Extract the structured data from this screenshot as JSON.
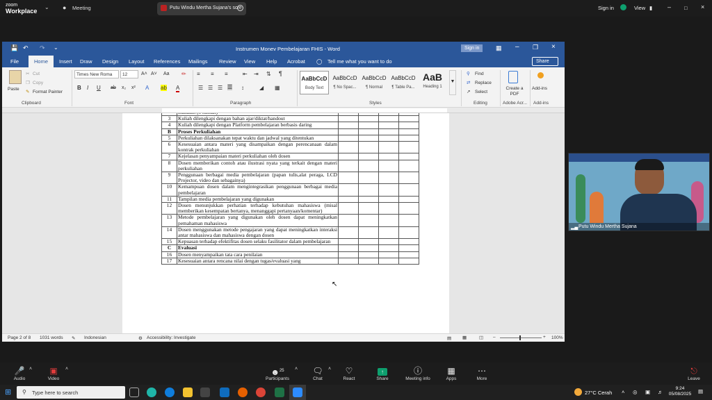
{
  "zoom_top": {
    "logo_line1": "zoom",
    "logo_line2": "Workplace",
    "meeting_label": "Meeting",
    "share_tab": "Putu Windu Mertha Sujana's scre",
    "sign_in": "Sign in",
    "view": "View"
  },
  "word": {
    "title": "Instrumen Monev Pembelajaran FHIS  -  Word",
    "signin": "Sign in",
    "share": "Share",
    "menu": [
      "File",
      "Home",
      "Insert",
      "Draw",
      "Design",
      "Layout",
      "References",
      "Mailings",
      "Review",
      "View",
      "Help",
      "Acrobat"
    ],
    "tell_me": "Tell me what you want to do",
    "ribbon": {
      "paste": "Paste",
      "cut": "Cut",
      "copy": "Copy",
      "format_painter": "Format Painter",
      "clipboard": "Clipboard",
      "font_name": "Times New Roma",
      "font_size": "12",
      "font": "Font",
      "paragraph": "Paragraph",
      "styles_label": "Styles",
      "styles": [
        {
          "preview": "AaBbCcD",
          "name": "Body Text"
        },
        {
          "preview": "AaBbCcD",
          "name": "¶ No Spac..."
        },
        {
          "preview": "AaBbCcD",
          "name": "¶ Normal"
        },
        {
          "preview": "AaBbCcD",
          "name": "¶ Table Pa..."
        },
        {
          "preview": "AaB",
          "name": "Heading 1"
        }
      ],
      "find": "Find",
      "replace": "Replace",
      "select": "Select",
      "editing": "Editing",
      "create_pdf": "Create a PDF",
      "adobe": "Adobe Acr...",
      "addins": "Add-ins",
      "addins_group": "Add-ins"
    },
    "table_rows": [
      {
        "no": "",
        "text": "makalah (3 tulisan)",
        "bold": false
      },
      {
        "no": "3",
        "text": "Kuliah dilengkapi dengan bahan ajar/diktat/handout",
        "bold": false
      },
      {
        "no": "4",
        "text": "Kuliah dilengkapi dengan Platform pembelajaran berbasis daring",
        "bold": false
      },
      {
        "no": "B",
        "text": "Proses Perkuliahan",
        "bold": true
      },
      {
        "no": "5",
        "text": "Perkuliahan dilaksanakan tepat waktu dan jadwal yang ditentukan",
        "bold": false
      },
      {
        "no": "6",
        "text": "Kesesuaian antara materi yang disampaikan dengan perencanaan dalam kontrak perkuliahan",
        "bold": false
      },
      {
        "no": "7",
        "text": "Kejelasan penyampaian materi perkuliahan oleh dosen",
        "bold": false
      },
      {
        "no": "8",
        "text": "Dosen memberikan contoh atau ilustrasi nyata yang terkait dengan materi perkuliahan",
        "bold": false
      },
      {
        "no": "9",
        "text": "Penggunaan berbagai media pembelajaran (papan tulis,alat peraga, LCD Projector, video dan sebagainya)",
        "bold": false
      },
      {
        "no": "10",
        "text": "Kemampuan dosen dalam mengintegrasikan penggunaan berbagai media pembelajaran",
        "bold": false
      },
      {
        "no": "11",
        "text": "Tampilan media pembelajaran yang digunakan",
        "bold": false
      },
      {
        "no": "12",
        "text": "Dosen menunjukkan perhatian terhadap kebutuhan mahasiswa (misal memberikan kesempatan bertanya, menanggapi pertanyaan/komentar)",
        "bold": false
      },
      {
        "no": "13",
        "text": "Metode pembelajaran yang digunakan oleh dosen dapat meningkatkan pemahaman mahasiswa",
        "bold": false
      },
      {
        "no": "14",
        "text": "Dosen menggunakan metode pengajaran yang dapat meningkatkan interaksi antar mahasiswa dan mahasiswa dengan dosen",
        "bold": false
      },
      {
        "no": "15",
        "text": "Kepuasan terhadap efektifitas dosen selaku fasilitator dalam pembelajaran",
        "bold": false
      },
      {
        "no": "C",
        "text": "Evaluasi",
        "bold": true
      },
      {
        "no": "16",
        "text": "Dosen menyampaikan tata cara penilaian",
        "bold": false
      },
      {
        "no": "17",
        "text": "Kesesuaian antara rencana nilai dengan tugas/evaluasi yang",
        "bold": false
      }
    ],
    "status": {
      "page": "Page 2 of 8",
      "words": "1031 words",
      "language": "Indonesian",
      "accessibility": "Accessibility: Investigate",
      "zoom": "100%"
    }
  },
  "video": {
    "name": "Putu Windu Mertha Sujana"
  },
  "zoom_bottom": [
    {
      "icon": "mic-muted-icon",
      "label": "Audio"
    },
    {
      "icon": "video-off-icon",
      "label": "Video"
    },
    {
      "icon": "participants-icon",
      "label": "Participants",
      "count": "25"
    },
    {
      "icon": "chat-icon",
      "label": "Chat"
    },
    {
      "icon": "react-icon",
      "label": "React"
    },
    {
      "icon": "share-icon",
      "label": "Share"
    },
    {
      "icon": "info-icon",
      "label": "Meeting info"
    },
    {
      "icon": "apps-icon",
      "label": "Apps"
    },
    {
      "icon": "more-icon",
      "label": "More"
    },
    {
      "icon": "leave-icon",
      "label": "Leave"
    }
  ],
  "taskbar": {
    "search": "Type here to search",
    "weather": "27°C  Cerah",
    "time": "9:24",
    "date": "05/08/2025"
  },
  "colors": {
    "word_blue": "#2b579a",
    "zoom_dark": "#1c1c1c",
    "share_green": "#0e9f6e"
  }
}
